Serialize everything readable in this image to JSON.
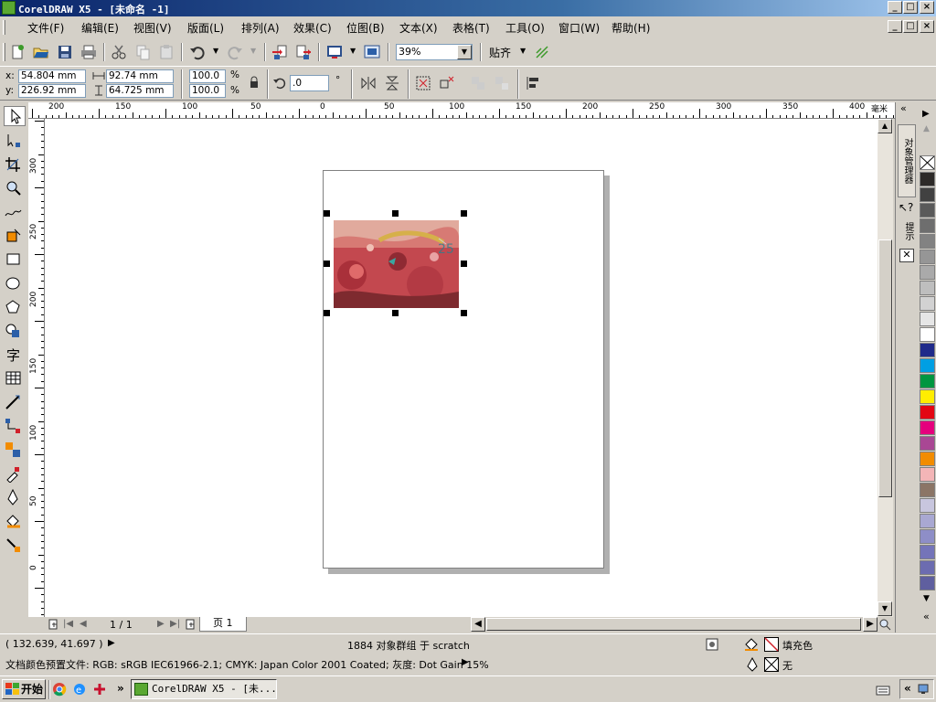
{
  "window": {
    "title": "CorelDRAW X5 - [未命名 -1]",
    "minimize": "_",
    "maximize": "□",
    "close": "×",
    "doc_minimize": "_",
    "doc_restore": "□",
    "doc_close": "×"
  },
  "menu": [
    "文件(F)",
    "编辑(E)",
    "视图(V)",
    "版面(L)",
    "排列(A)",
    "效果(C)",
    "位图(B)",
    "文本(X)",
    "表格(T)",
    "工具(O)",
    "窗口(W)",
    "帮助(H)"
  ],
  "toolbar": {
    "zoom": "39%",
    "snap": "贴齐",
    "snap_arrow": "▼",
    "zoom_arrow": "▼",
    "icons": [
      "new-icon",
      "open-icon",
      "save-icon",
      "print-icon",
      "cut-icon",
      "copy-icon",
      "paste-icon",
      "undo-icon",
      "redo-icon",
      "import-icon",
      "export-icon",
      "app-launcher-icon",
      "welcome-screen-icon",
      "snap-options-icon"
    ]
  },
  "properties": {
    "x_label": "x:",
    "x_value": "54.804 mm",
    "y_label": "y:",
    "y_value": "226.92 mm",
    "w_value": "92.74 mm",
    "h_value": "64.725 mm",
    "scale_x": "100.0",
    "scale_y": "100.0",
    "pct": "%",
    "rotation": ".0",
    "degree": "°"
  },
  "rulers": {
    "h_labels": [
      "200",
      "150",
      "100",
      "50",
      "0",
      "50",
      "100",
      "150",
      "200",
      "250",
      "300",
      "350",
      "400"
    ],
    "unit": "毫米",
    "v_labels": [
      "300",
      "250",
      "200",
      "150",
      "100",
      "50",
      "0"
    ]
  },
  "page_nav": {
    "page_count": "1 / 1",
    "tab": "页 1"
  },
  "status": {
    "coords": "( 132.639, 41.697 )",
    "selection": "1884 对象群组 于 scratch",
    "profile": "文档颜色预置文件: RGB: sRGB IEC61966-2.1; CMYK: Japan Color 2001 Coated; 灰度: Dot Gain 15%",
    "fill": "填充色",
    "outline": "无"
  },
  "docker_tabs": {
    "object_manager": "对象管理器",
    "hints": "提示"
  },
  "palette": [
    "#2d2a28",
    "#414141",
    "#5a5a5a",
    "#6e6e6e",
    "#828282",
    "#969696",
    "#aaaaaa",
    "#bebebe",
    "#d2d2d2",
    "#e6e6e6",
    "#ffffff",
    "#1f2a8a",
    "#009fe3",
    "#009640",
    "#ffed00",
    "#e30613",
    "#e5007d",
    "#a94794",
    "#f28c00",
    "#f3b5b7",
    "#8b7566",
    "#c8c6de",
    "#a9a8d2",
    "#8e8ec7",
    "#7474b9",
    "#6c6cb0",
    "#5f5f9f"
  ],
  "taskbar": {
    "start": "开始",
    "task": "CorelDRAW X5 - [未...",
    "more": "»"
  }
}
